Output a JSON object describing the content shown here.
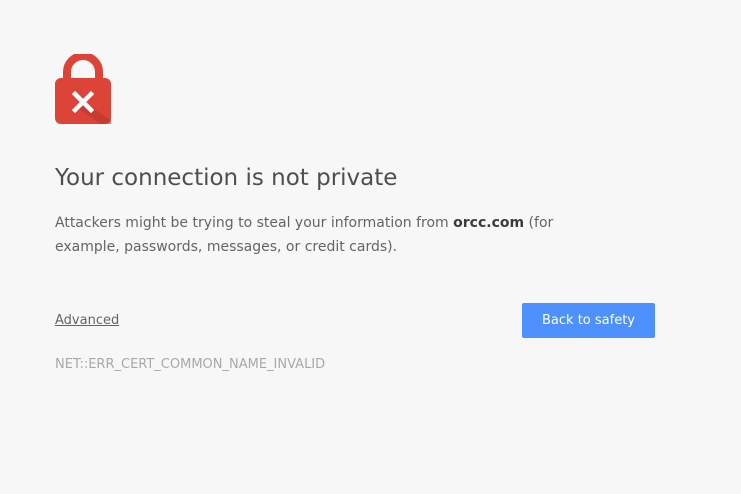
{
  "icon": "lock-error-icon",
  "colors": {
    "lock": "#db4437",
    "button": "#4d90fe",
    "background": "#f7f7f7"
  },
  "heading": "Your connection is not private",
  "explanation": {
    "prefix": "Attackers might be trying to steal your information from ",
    "domain": "orcc.com",
    "suffix": " (for example, passwords, messages, or credit cards)."
  },
  "advanced_link": "Advanced",
  "back_button": "Back to safety",
  "error_code": "NET::ERR_CERT_COMMON_NAME_INVALID"
}
